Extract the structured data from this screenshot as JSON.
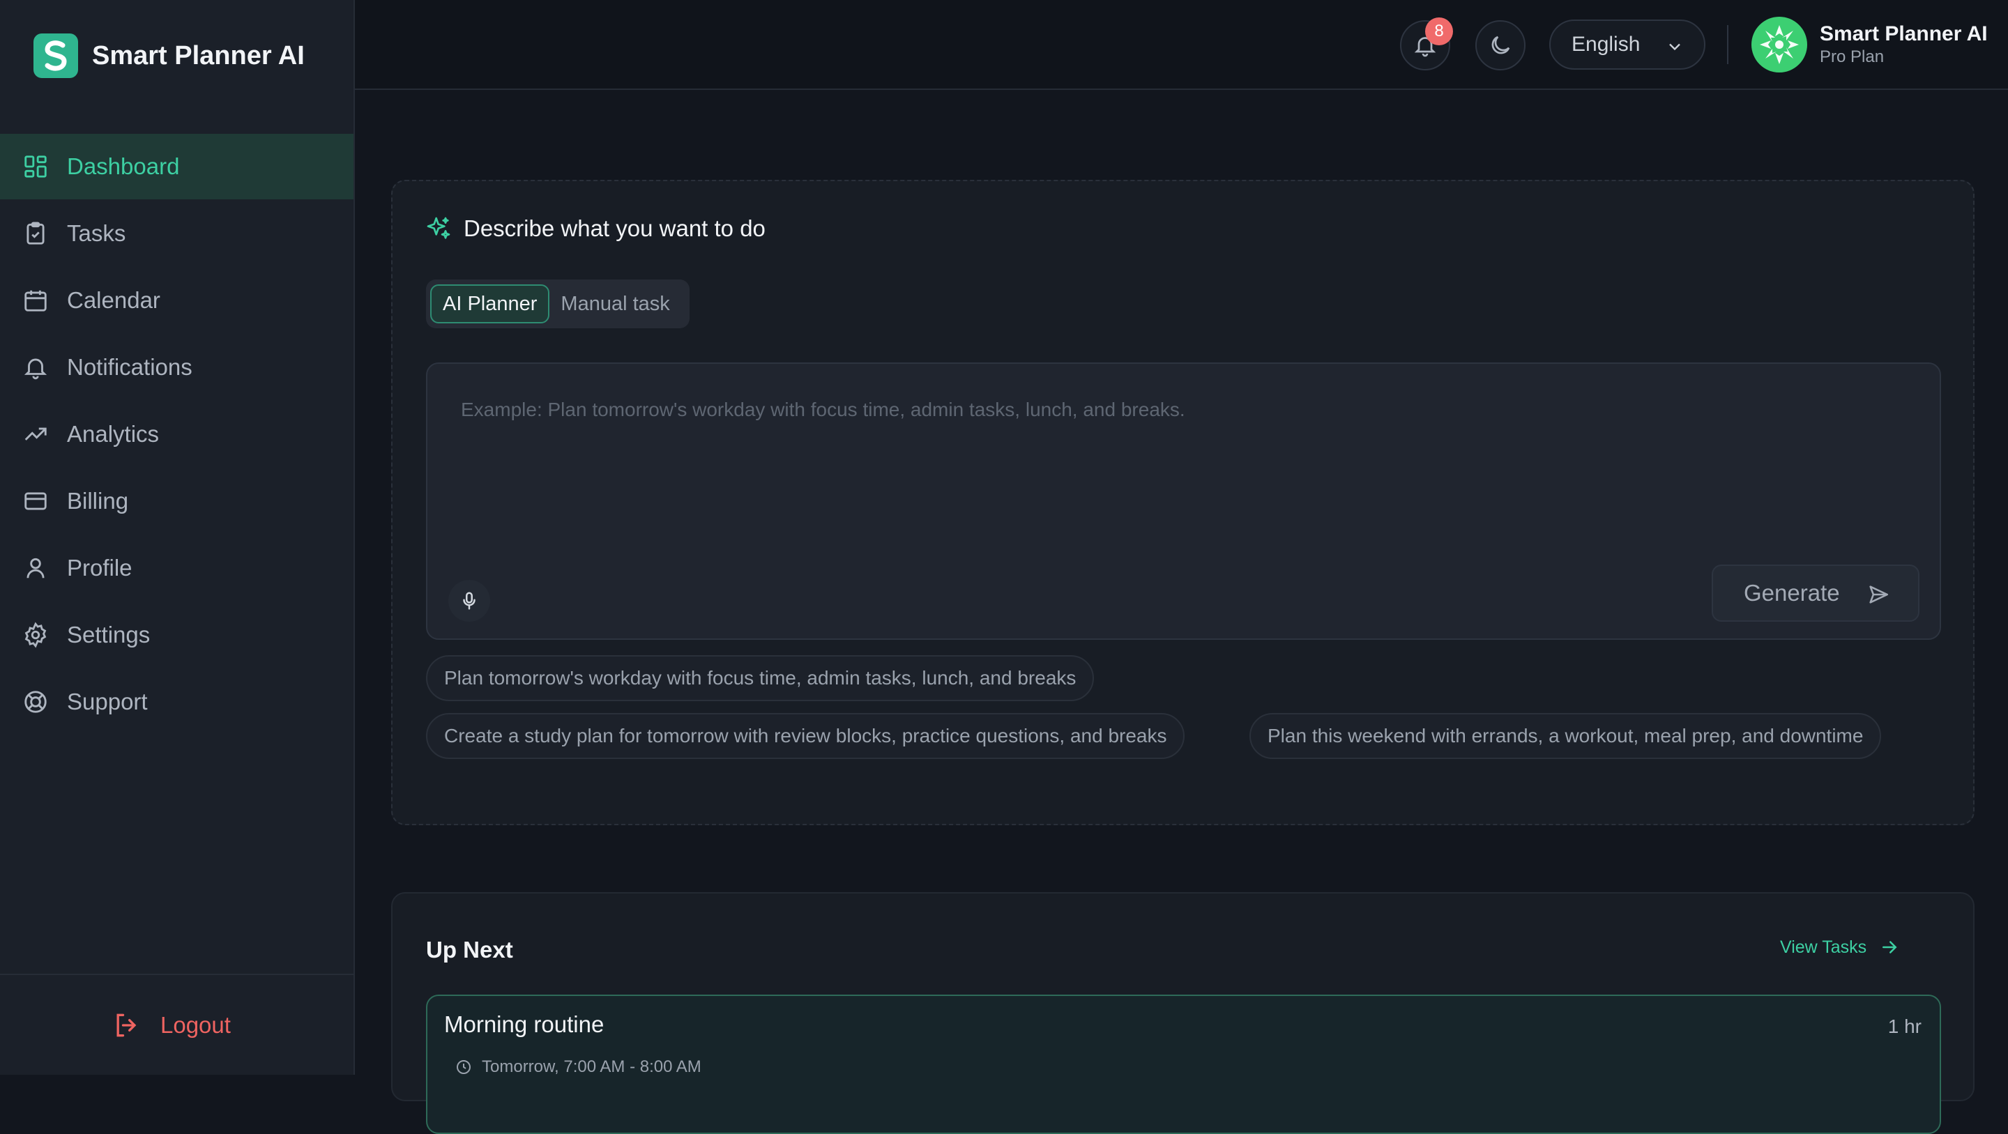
{
  "colors": {
    "accent": "#3dd0a3",
    "danger": "#ef6461",
    "badge": "#f06a6a",
    "background": "#12161e"
  },
  "brand": {
    "name": "Smart Planner AI"
  },
  "sidebar": {
    "items": [
      {
        "label": "Dashboard",
        "icon": "dashboard-icon"
      },
      {
        "label": "Tasks",
        "icon": "clipboard-check-icon"
      },
      {
        "label": "Calendar",
        "icon": "calendar-icon"
      },
      {
        "label": "Notifications",
        "icon": "bell-icon"
      },
      {
        "label": "Analytics",
        "icon": "trending-up-icon"
      },
      {
        "label": "Billing",
        "icon": "credit-card-icon"
      },
      {
        "label": "Profile",
        "icon": "user-icon"
      },
      {
        "label": "Settings",
        "icon": "gear-icon"
      },
      {
        "label": "Support",
        "icon": "lifebuoy-icon"
      }
    ],
    "logout_label": "Logout"
  },
  "header": {
    "notification_count": "8",
    "language": "English",
    "user_name": "Smart Planner AI",
    "user_plan": "Pro Plan"
  },
  "planner": {
    "title": "Describe what you want to do",
    "tabs": [
      "AI Planner",
      "Manual task"
    ],
    "placeholder": "Example: Plan tomorrow's workday with focus time, admin tasks, lunch, and breaks.",
    "generate_label": "Generate",
    "suggestions": [
      "Plan tomorrow's workday with focus time, admin tasks, lunch, and breaks",
      "Create a study plan for tomorrow with review blocks, practice questions, and breaks",
      "Plan this weekend with errands, a workout, meal prep, and downtime"
    ]
  },
  "up_next": {
    "title": "Up Next",
    "view_tasks_label": "View Tasks",
    "task": {
      "title": "Morning routine",
      "duration": "1 hr",
      "time": "Tomorrow, 7:00 AM - 8:00 AM"
    }
  }
}
